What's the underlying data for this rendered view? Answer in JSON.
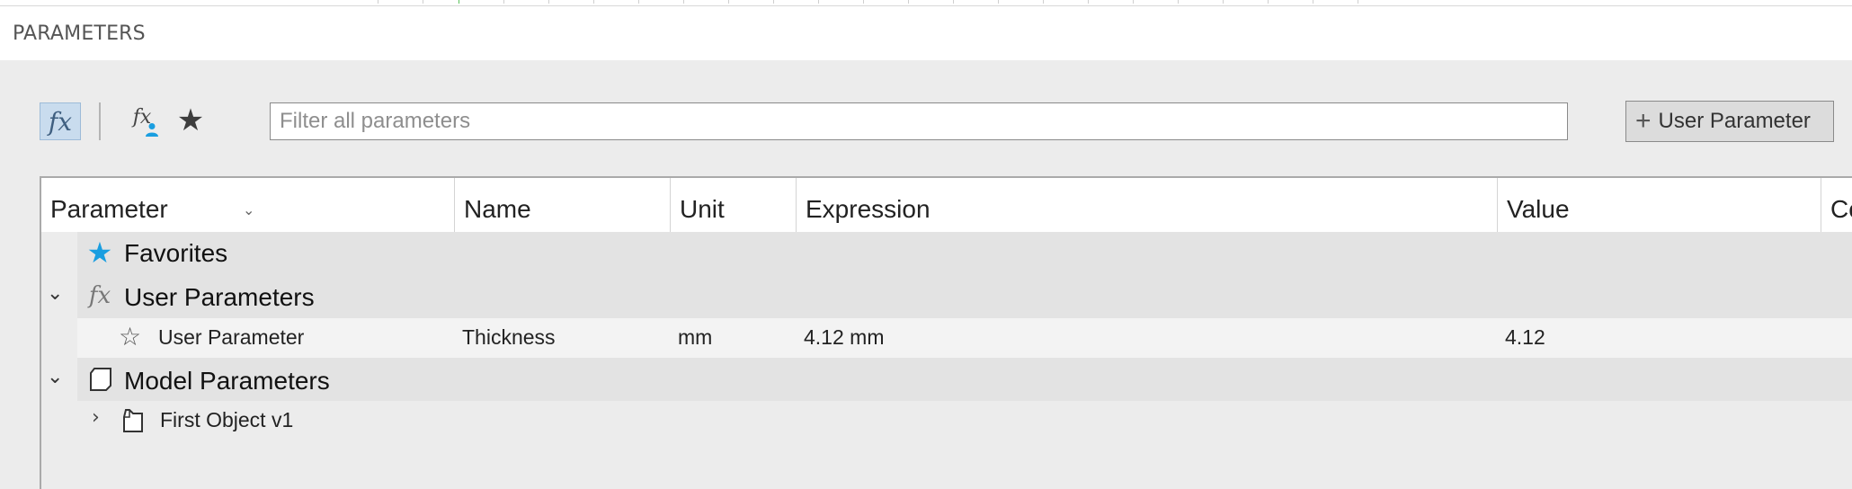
{
  "window": {
    "title": "PARAMETERS"
  },
  "toolbar": {
    "filter_placeholder": "Filter all parameters",
    "filter_value": "",
    "add_button_label": "User Parameter",
    "icons": [
      "fx-icon",
      "fx-user-icon",
      "star-icon",
      "plus-icon"
    ]
  },
  "table": {
    "columns": [
      "Parameter",
      "Name",
      "Unit",
      "Expression",
      "Value",
      "Co"
    ],
    "groups": {
      "favorites": {
        "label": "Favorites"
      },
      "user": {
        "label": "User Parameters"
      },
      "model": {
        "label": "Model Parameters"
      }
    },
    "user_rows": [
      {
        "parameter": "User Parameter",
        "name": "Thickness",
        "unit": "mm",
        "expression": "4.12 mm",
        "value": "4.12"
      }
    ],
    "model_rows": [
      {
        "parameter": "First Object v1"
      }
    ]
  },
  "colors": {
    "favorite_star": "#1a9ee0",
    "active_tool_bg": "#c9dcee",
    "user_icon_blue": "#1a9ee0"
  }
}
